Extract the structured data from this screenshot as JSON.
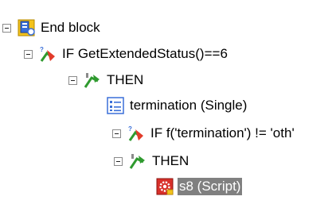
{
  "tree": {
    "root": {
      "label": "End block",
      "icon": "end-block-icon"
    },
    "if1": {
      "label": "IF GetExtendedStatus()==6",
      "icon": "if-branch-icon"
    },
    "then1": {
      "label": "THEN",
      "icon": "then-branch-icon"
    },
    "termination": {
      "label": "termination (Single)",
      "icon": "list-variable-icon"
    },
    "if2": {
      "label": "IF f('termination') != 'oth'",
      "icon": "if-branch-icon"
    },
    "then2": {
      "label": "THEN",
      "icon": "then-branch-icon"
    },
    "script": {
      "label": "s8 (Script)",
      "icon": "script-gear-icon",
      "selected": true
    }
  },
  "colors": {
    "selection_bg": "#808080",
    "selection_text": "#ffffff",
    "toggle_border": "#8a8a8a"
  }
}
